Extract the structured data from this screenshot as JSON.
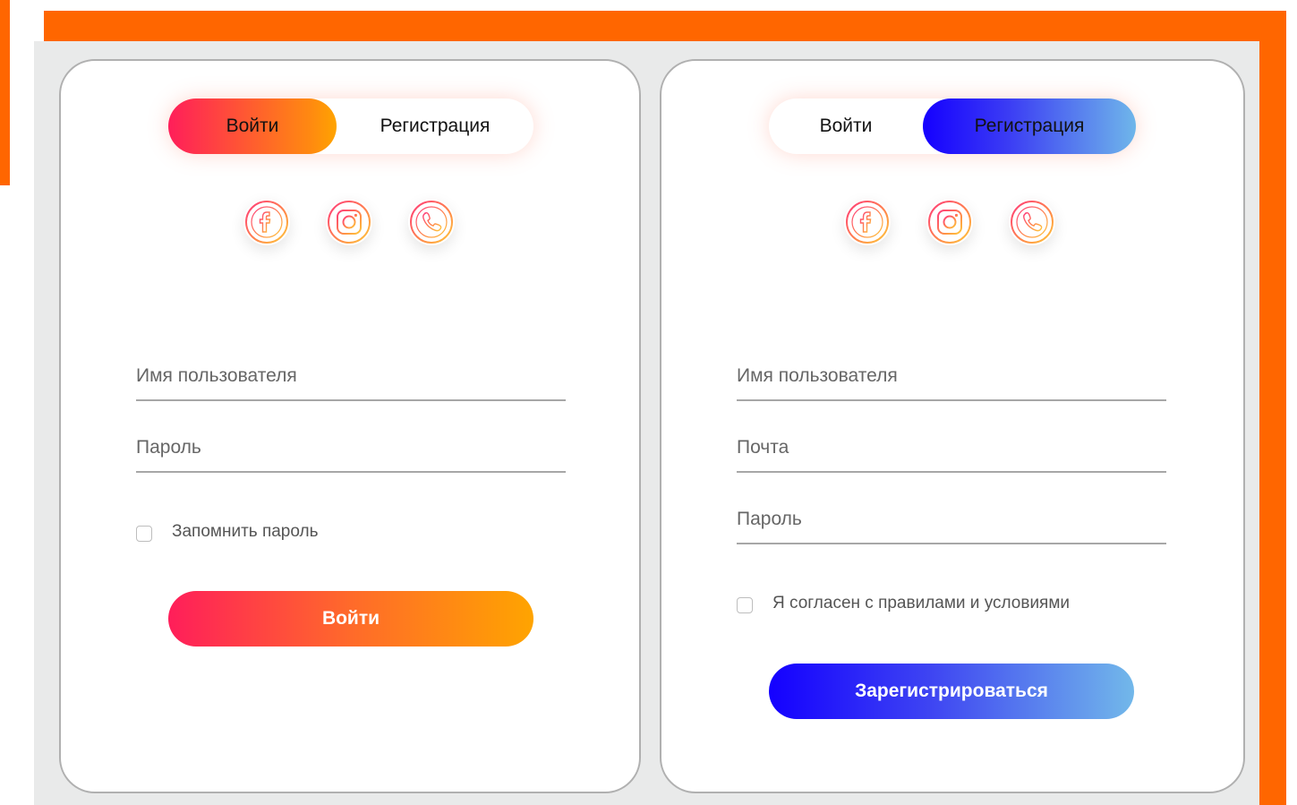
{
  "colors": {
    "frame": "#ff6600",
    "stage": "#e9eaea",
    "login_gradient": [
      "#ff1e5a",
      "#ffa400"
    ],
    "register_gradient": [
      "#1500ff",
      "#6fb6ea"
    ]
  },
  "login_card": {
    "tabs": {
      "login": "Войти",
      "register": "Регистрация",
      "active": "login"
    },
    "socials": [
      "facebook-icon",
      "instagram-icon",
      "phone-icon"
    ],
    "username_placeholder": "Имя пользователя",
    "password_placeholder": "Пароль",
    "remember_label": "Запомнить пароль",
    "remember_checked": false,
    "submit_label": "Войти"
  },
  "register_card": {
    "tabs": {
      "login": "Войти",
      "register": "Регистрация",
      "active": "register"
    },
    "socials": [
      "facebook-icon",
      "instagram-icon",
      "phone-icon"
    ],
    "username_placeholder": "Имя пользователя",
    "email_placeholder": "Почта",
    "password_placeholder": "Пароль",
    "terms_label": "Я согласен с правилами и условиями",
    "terms_checked": false,
    "submit_label": "Зарегистрироваться"
  }
}
